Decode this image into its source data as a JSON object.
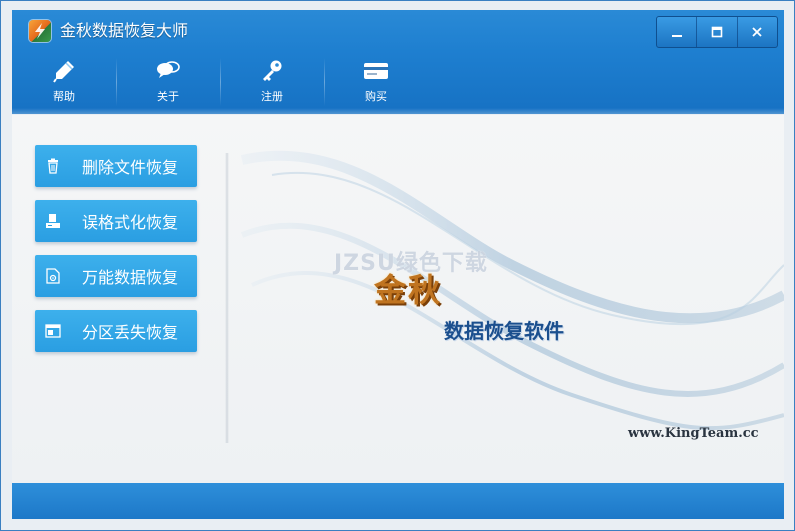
{
  "window": {
    "title": "金秋数据恢复大师",
    "controls": {
      "minimize": "─",
      "maximize": "☐",
      "close": "✕"
    }
  },
  "toolbar": {
    "items": [
      {
        "label": "帮助",
        "icon": "help-pen-icon"
      },
      {
        "label": "关于",
        "icon": "chat-bubbles-icon"
      },
      {
        "label": "注册",
        "icon": "key-icon"
      },
      {
        "label": "购买",
        "icon": "card-icon"
      }
    ]
  },
  "sidebar": {
    "items": [
      {
        "label": "删除文件恢复",
        "icon": "trash-icon"
      },
      {
        "label": "误格式化恢复",
        "icon": "drive-format-icon"
      },
      {
        "label": "万能数据恢复",
        "icon": "file-gear-icon"
      },
      {
        "label": "分区丢失恢复",
        "icon": "partition-icon"
      }
    ]
  },
  "brand": {
    "name": "金秋",
    "watermark": "JZSU绿色下载",
    "subtitle": "数据恢复软件",
    "url": "www.KingTeam.cc"
  },
  "colors": {
    "header_blue": "#1e7fd0",
    "button_blue": "#2a9ee2",
    "brand_gold": "#c07420",
    "subtitle_navy": "#1b4f8e"
  }
}
